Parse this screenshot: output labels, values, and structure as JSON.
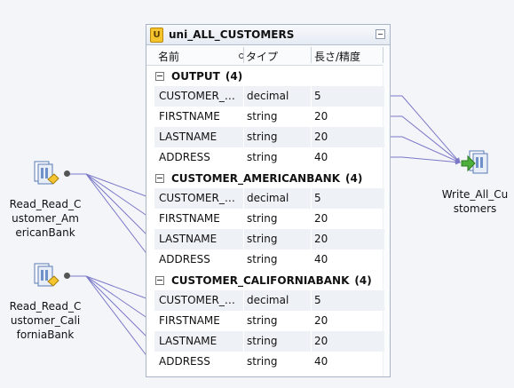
{
  "transformation": {
    "title": "uni_ALL_CUSTOMERS",
    "columns": {
      "name": "名前",
      "type": "タイプ",
      "precision": "長さ/精度"
    }
  },
  "groups": [
    {
      "label": "OUTPUT",
      "count": "(4)",
      "fields": [
        {
          "name": "CUSTOMER_…",
          "type": "decimal",
          "precision": "5"
        },
        {
          "name": "FIRSTNAME",
          "type": "string",
          "precision": "20"
        },
        {
          "name": "LASTNAME",
          "type": "string",
          "precision": "20"
        },
        {
          "name": "ADDRESS",
          "type": "string",
          "precision": "40"
        }
      ]
    },
    {
      "label": "CUSTOMER_AMERICANBANK",
      "count": "(4)",
      "fields": [
        {
          "name": "CUSTOMER_…",
          "type": "decimal",
          "precision": "5"
        },
        {
          "name": "FIRSTNAME",
          "type": "string",
          "precision": "20"
        },
        {
          "name": "LASTNAME",
          "type": "string",
          "precision": "20"
        },
        {
          "name": "ADDRESS",
          "type": "string",
          "precision": "40"
        }
      ]
    },
    {
      "label": "CUSTOMER_CALIFORNIABANK",
      "count": "(4)",
      "fields": [
        {
          "name": "CUSTOMER_…",
          "type": "decimal",
          "precision": "5"
        },
        {
          "name": "FIRSTNAME",
          "type": "string",
          "precision": "20"
        },
        {
          "name": "LASTNAME",
          "type": "string",
          "precision": "20"
        },
        {
          "name": "ADDRESS",
          "type": "string",
          "precision": "40"
        }
      ]
    }
  ],
  "sources": [
    {
      "lines": [
        "Read_Read_C",
        "ustomer_Am",
        "ericanBank"
      ]
    },
    {
      "lines": [
        "Read_Read_C",
        "ustomer_Cali",
        "forniaBank"
      ]
    }
  ],
  "target": {
    "lines": [
      "Write_All_Cu",
      "stomers"
    ]
  },
  "colors": {
    "link": "#7b78c8",
    "accent": "#f5c32c"
  }
}
